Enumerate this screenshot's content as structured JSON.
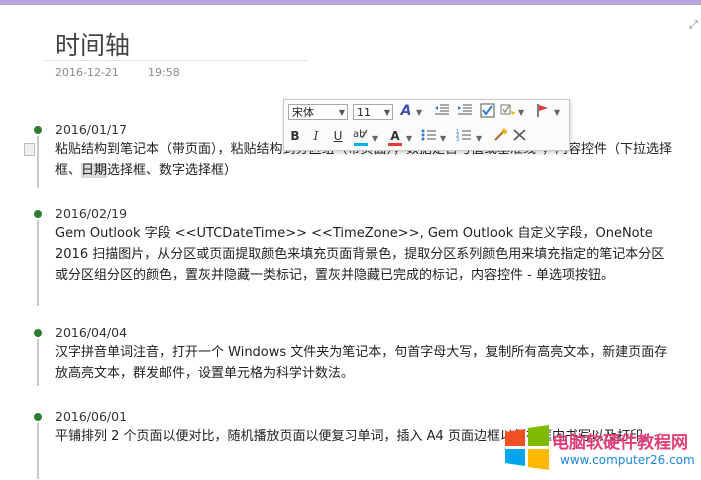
{
  "page": {
    "title": "时间轴",
    "date": "2016-12-21",
    "time": "19:58"
  },
  "entries": [
    {
      "date": "2016/01/17",
      "text_before": "粘贴结构到笔记本（带页面），粘贴结构到分区组（带页面），数据是否与值或基准线\"，内容控件（下拉选择框、",
      "text_selected": "日期",
      "text_after": "选择框、数字选择框）"
    },
    {
      "date": "2016/02/19",
      "text": "Gem Outlook 字段 <<UTCDateTime>> <<TimeZone>>, Gem Outlook 自定义字段，OneNote 2016 扫描图片，从分区或页面提取颜色来填充页面背景色，提取分区系列颜色用来填充指定的笔记本分区或分区组分区的颜色，置灰并隐藏一类标记，置灰并隐藏已完成的标记，内容控件 - 单选项按钮。"
    },
    {
      "date": "2016/04/04",
      "text": "汉字拼音单词注音，打开一个 Windows 文件夹为笔记本，句首字母大写，复制所有高亮文本，新建页面存放高亮文本，群发邮件，设置单元格为科学计数法。"
    },
    {
      "date": "2016/06/01",
      "text": "平铺排列 2 个页面以便对比，随机播放页面以便复习单词，插入 A4 页面边框以便在框内书写以及打印。"
    }
  ],
  "toolbar": {
    "font_name": "宋体",
    "font_size": "11",
    "bold": "B",
    "italic": "I",
    "underline": "U",
    "font_color_letter": "A",
    "styles_letter": "A",
    "highlight_color": "#00b0f0",
    "font_color": "#e53935"
  },
  "watermark": {
    "site_name": "电脑软硬件教程网",
    "site_url": "www.computer26.com"
  },
  "colors": {
    "accent_bar": "#b6a6d8",
    "timeline_dot": "#2e7d32"
  }
}
